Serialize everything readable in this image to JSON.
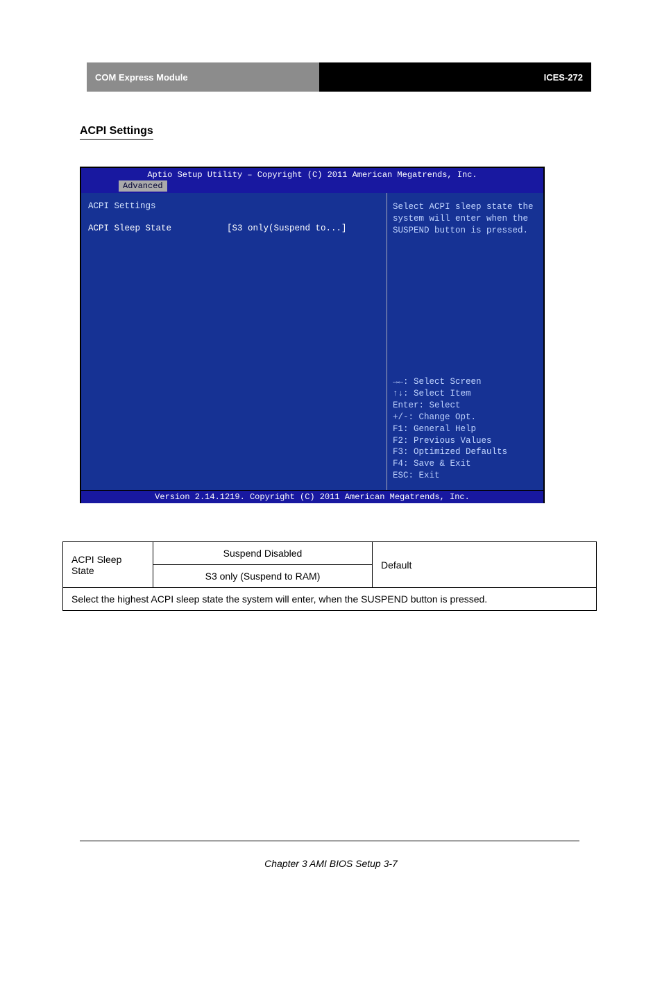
{
  "doc_header": {
    "left": "COM Express Module",
    "right": "ICES-272"
  },
  "section_label": "ACPI Settings",
  "bios": {
    "title": "Aptio Setup Utility – Copyright (C) 2011 American Megatrends, Inc.",
    "active_tab": "Advanced",
    "heading": "ACPI Settings",
    "item_label": "ACPI Sleep State",
    "item_value": "[S3 only(Suspend to...]",
    "help_top": "Select ACPI sleep state the system will enter when the SUSPEND button is pressed.",
    "help_keys": [
      "→←: Select Screen",
      "↑↓: Select Item",
      "Enter: Select",
      "+/-: Change Opt.",
      "F1: General Help",
      "F2: Previous Values",
      "F3: Optimized Defaults",
      "F4: Save & Exit",
      "ESC: Exit"
    ],
    "footer": "Version 2.14.1219. Copyright (C) 2011 American Megatrends, Inc."
  },
  "table": {
    "row1_label": "ACPI Sleep State",
    "row1_opt1": "Suspend Disabled",
    "row1_opt2": "S3 only (Suspend to RAM)",
    "row1_default": "Default",
    "row2_note": "Select the highest ACPI sleep state the system will enter, when the SUSPEND button is pressed."
  },
  "footer": "Chapter 3 AMI BIOS Setup   3-7"
}
